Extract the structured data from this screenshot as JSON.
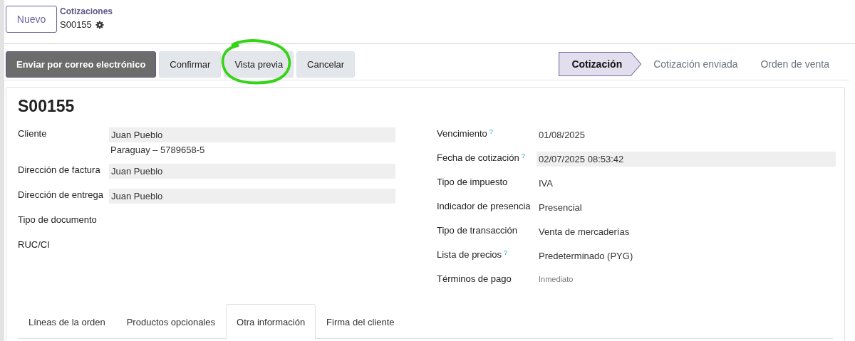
{
  "new_button": "Nuevo",
  "breadcrumb": {
    "parent": "Cotizaciones",
    "record": "S00155"
  },
  "actions": [
    {
      "label": "Enviar por correo electrónico",
      "primary": true,
      "circled": false
    },
    {
      "label": "Confirmar",
      "primary": false,
      "circled": false
    },
    {
      "label": "Vista previa",
      "primary": false,
      "circled": true
    },
    {
      "label": "Cancelar",
      "primary": false,
      "circled": false
    }
  ],
  "status_steps": [
    {
      "label": "Cotización",
      "selected": true
    },
    {
      "label": "Cotización enviada",
      "selected": false
    },
    {
      "label": "Orden de venta",
      "selected": false
    }
  ],
  "form": {
    "title": "S00155",
    "left_fields": [
      {
        "label": "Cliente",
        "value": "Juan Pueblo",
        "filled": true,
        "subtext": "Paraguay – 5789658-5"
      },
      {
        "label": "Dirección de factura",
        "value": "Juan Pueblo",
        "filled": true
      },
      {
        "label": "Dirección de entrega",
        "value": "Juan Pueblo",
        "filled": true
      },
      {
        "label": "Tipo de documento"
      },
      {
        "label": "RUC/CI"
      }
    ],
    "right_fields": [
      {
        "label": "Vencimiento",
        "help_mark": "?",
        "value": "01/08/2025",
        "filled": false
      },
      {
        "label": "Fecha de cotización",
        "help_mark": "?",
        "value": "02/07/2025 08:53:42",
        "filled": true
      },
      {
        "label": "Tipo de impuesto",
        "value": "IVA",
        "filled": false
      },
      {
        "label": "Indicador de presencia",
        "value": "Presencial",
        "filled": false
      },
      {
        "label": "Tipo de transacción",
        "value": "Venta de mercaderías",
        "filled": false
      },
      {
        "label": "Lista de precios",
        "help_mark": "?",
        "value": "Predeterminado (PYG)",
        "filled": false
      },
      {
        "label": "Términos de pago",
        "placeholder": "Inmediato"
      }
    ],
    "tabs": [
      {
        "label": "Líneas de la orden",
        "selected": false
      },
      {
        "label": "Productos opcionales",
        "selected": false
      },
      {
        "label": "Otra información",
        "selected": true
      },
      {
        "label": "Firma del cliente",
        "selected": false
      }
    ]
  }
}
